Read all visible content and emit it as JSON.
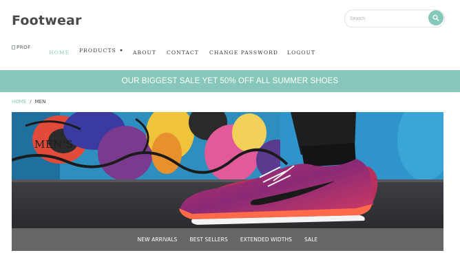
{
  "header": {
    "brand": "Footwear",
    "search": {
      "placeholder": "Search",
      "button_icon": "search-icon"
    },
    "logo_alt": "PROF"
  },
  "nav": {
    "items": [
      {
        "label": "HOME",
        "active": true
      },
      {
        "label": "PRODUCTS",
        "dropdown": true
      },
      {
        "label": "ABOUT"
      },
      {
        "label": "CONTACT"
      },
      {
        "label": "CHANGE PASSWORD"
      },
      {
        "label": "LOGOUT"
      }
    ]
  },
  "promo_banner": {
    "text": "OUR BIGGEST SALE YET 50% OFF ALL SUMMER SHOES"
  },
  "breadcrumb": {
    "home": "HOME",
    "separator": "/",
    "current": "MEN"
  },
  "hero": {
    "title": "MEN'S"
  },
  "subnav": {
    "items": [
      "NEW ARRIVALS",
      "BEST SELLERS",
      "EXTENDED WIDTHS",
      "SALE"
    ]
  },
  "colors": {
    "accent": "#85c9bb",
    "banner_bg": "#87c7b9",
    "subnav_bg": "#666666",
    "text_dark": "#333333"
  }
}
